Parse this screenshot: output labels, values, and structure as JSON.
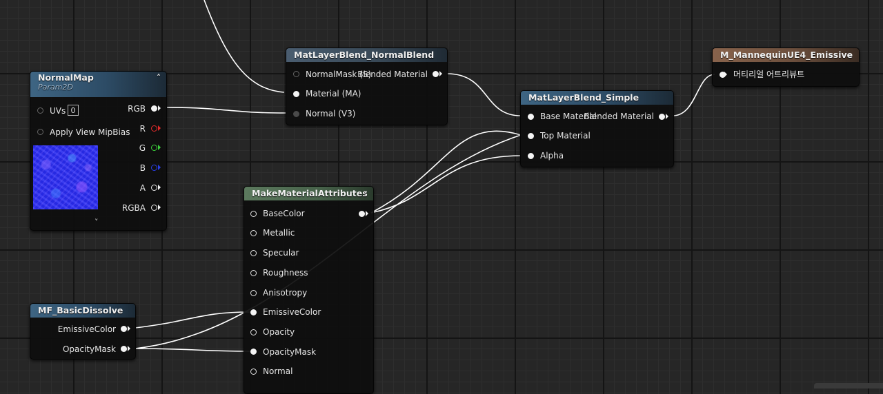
{
  "nodes": {
    "normalmap": {
      "title": "NormalMap",
      "subtitle": "Param2D",
      "inputs": {
        "uvs": "UVs",
        "uvs_value": "0",
        "mip": "Apply View MipBias"
      },
      "outputs": {
        "rgb": "RGB",
        "r": "R",
        "g": "G",
        "b": "B",
        "a": "A",
        "rgba": "RGBA"
      }
    },
    "normalblend": {
      "title": "MatLayerBlend_NormalBlend",
      "inputs": {
        "mask": "NormalMask (S)",
        "material": "Material (MA)",
        "normal": "Normal (V3)"
      },
      "outputs": {
        "blended": "Blended Material"
      }
    },
    "simple": {
      "title": "MatLayerBlend_Simple",
      "inputs": {
        "base": "Base Material",
        "top": "Top Material",
        "alpha": "Alpha"
      },
      "outputs": {
        "blended": "Blended Material"
      }
    },
    "output": {
      "title": "M_MannequinUE4_Emissive",
      "inputs": {
        "attributes": "머티리얼 어트리뷰트"
      }
    },
    "make": {
      "title": "MakeMaterialAttributes",
      "inputs": [
        "BaseColor",
        "Metallic",
        "Specular",
        "Roughness",
        "Anisotropy",
        "EmissiveColor",
        "Opacity",
        "OpacityMask",
        "Normal"
      ]
    },
    "dissolve": {
      "title": "MF_BasicDissolve",
      "outputs": {
        "emissive": "EmissiveColor",
        "opacity": "OpacityMask"
      }
    }
  },
  "icons": {
    "collapse": "chevron-up-icon",
    "expand": "chevron-down-icon",
    "pin": "pin-circle-icon"
  },
  "colors": {
    "wire": "#ffffff",
    "pin_red": "#e32a2a",
    "pin_green": "#3cd23c",
    "pin_blue": "#2a3fe6"
  }
}
